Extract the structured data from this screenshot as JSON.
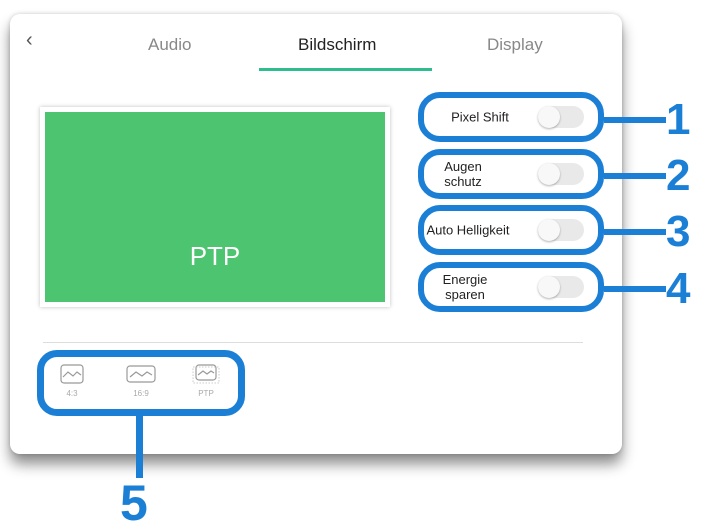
{
  "header": {
    "back_icon": "chevron-left-icon",
    "back_glyph": "‹",
    "tabs": [
      {
        "label": "Audio",
        "active": false
      },
      {
        "label": "Bildschirm",
        "active": true
      },
      {
        "label": "Display",
        "active": false
      }
    ]
  },
  "preview": {
    "text": "PTP",
    "color": "#4dc46f"
  },
  "options": [
    {
      "label": "Pixel Shift",
      "enabled": false,
      "marker": "1"
    },
    {
      "label": "Augen schutz",
      "enabled": false,
      "marker": "2"
    },
    {
      "label": "Auto Helligkeit",
      "enabled": false,
      "marker": "3"
    },
    {
      "label": "Energie sparen",
      "enabled": false,
      "marker": "4"
    }
  ],
  "aspect_ratios": {
    "items": [
      {
        "label": "4:3",
        "icon": "picture-icon"
      },
      {
        "label": "16:9",
        "icon": "picture-icon"
      },
      {
        "label": "PTP",
        "icon": "picture-icon"
      }
    ],
    "marker": "5"
  },
  "colors": {
    "accent": "#2dbd8e",
    "callout": "#1b7fd6"
  }
}
